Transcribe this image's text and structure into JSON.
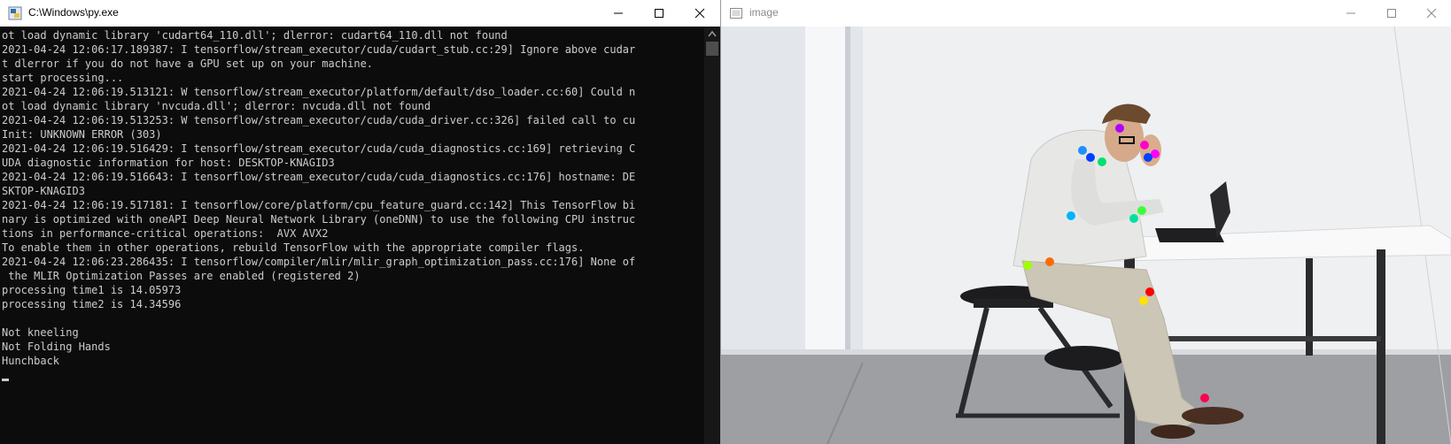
{
  "console_window": {
    "title": "C:\\Windows\\py.exe",
    "lines": [
      "ot load dynamic library 'cudart64_110.dll'; dlerror: cudart64_110.dll not found",
      "2021-04-24 12:06:17.189387: I tensorflow/stream_executor/cuda/cudart_stub.cc:29] Ignore above cudar",
      "t dlerror if you do not have a GPU set up on your machine.",
      "start processing...",
      "2021-04-24 12:06:19.513121: W tensorflow/stream_executor/platform/default/dso_loader.cc:60] Could n",
      "ot load dynamic library 'nvcuda.dll'; dlerror: nvcuda.dll not found",
      "2021-04-24 12:06:19.513253: W tensorflow/stream_executor/cuda/cuda_driver.cc:326] failed call to cu",
      "Init: UNKNOWN ERROR (303)",
      "2021-04-24 12:06:19.516429: I tensorflow/stream_executor/cuda/cuda_diagnostics.cc:169] retrieving C",
      "UDA diagnostic information for host: DESKTOP-KNAGID3",
      "2021-04-24 12:06:19.516643: I tensorflow/stream_executor/cuda/cuda_diagnostics.cc:176] hostname: DE",
      "SKTOP-KNAGID3",
      "2021-04-24 12:06:19.517181: I tensorflow/core/platform/cpu_feature_guard.cc:142] This TensorFlow bi",
      "nary is optimized with oneAPI Deep Neural Network Library (oneDNN) to use the following CPU instruc",
      "tions in performance-critical operations:  AVX AVX2",
      "To enable them in other operations, rebuild TensorFlow with the appropriate compiler flags.",
      "2021-04-24 12:06:23.286435: I tensorflow/compiler/mlir/mlir_graph_optimization_pass.cc:176] None of",
      " the MLIR Optimization Passes are enabled (registered 2)",
      "processing time1 is 14.05973",
      "processing time2 is 14.34596",
      "",
      "Not kneeling",
      "Not Folding Hands",
      "Hunchback"
    ]
  },
  "image_window": {
    "title": "image"
  },
  "colors": {
    "console_bg": "#0c0c0c",
    "console_text": "#cccccc",
    "keypoints": [
      "#b000ff",
      "#ff00c8",
      "#ff00ff",
      "#1e90ff",
      "#0040ff",
      "#00e070",
      "#00b4ff",
      "#3cff3c",
      "#00e0a0",
      "#a0ff00",
      "#ff6a00",
      "#ff0000",
      "#ffe000",
      "#ff0050"
    ]
  }
}
